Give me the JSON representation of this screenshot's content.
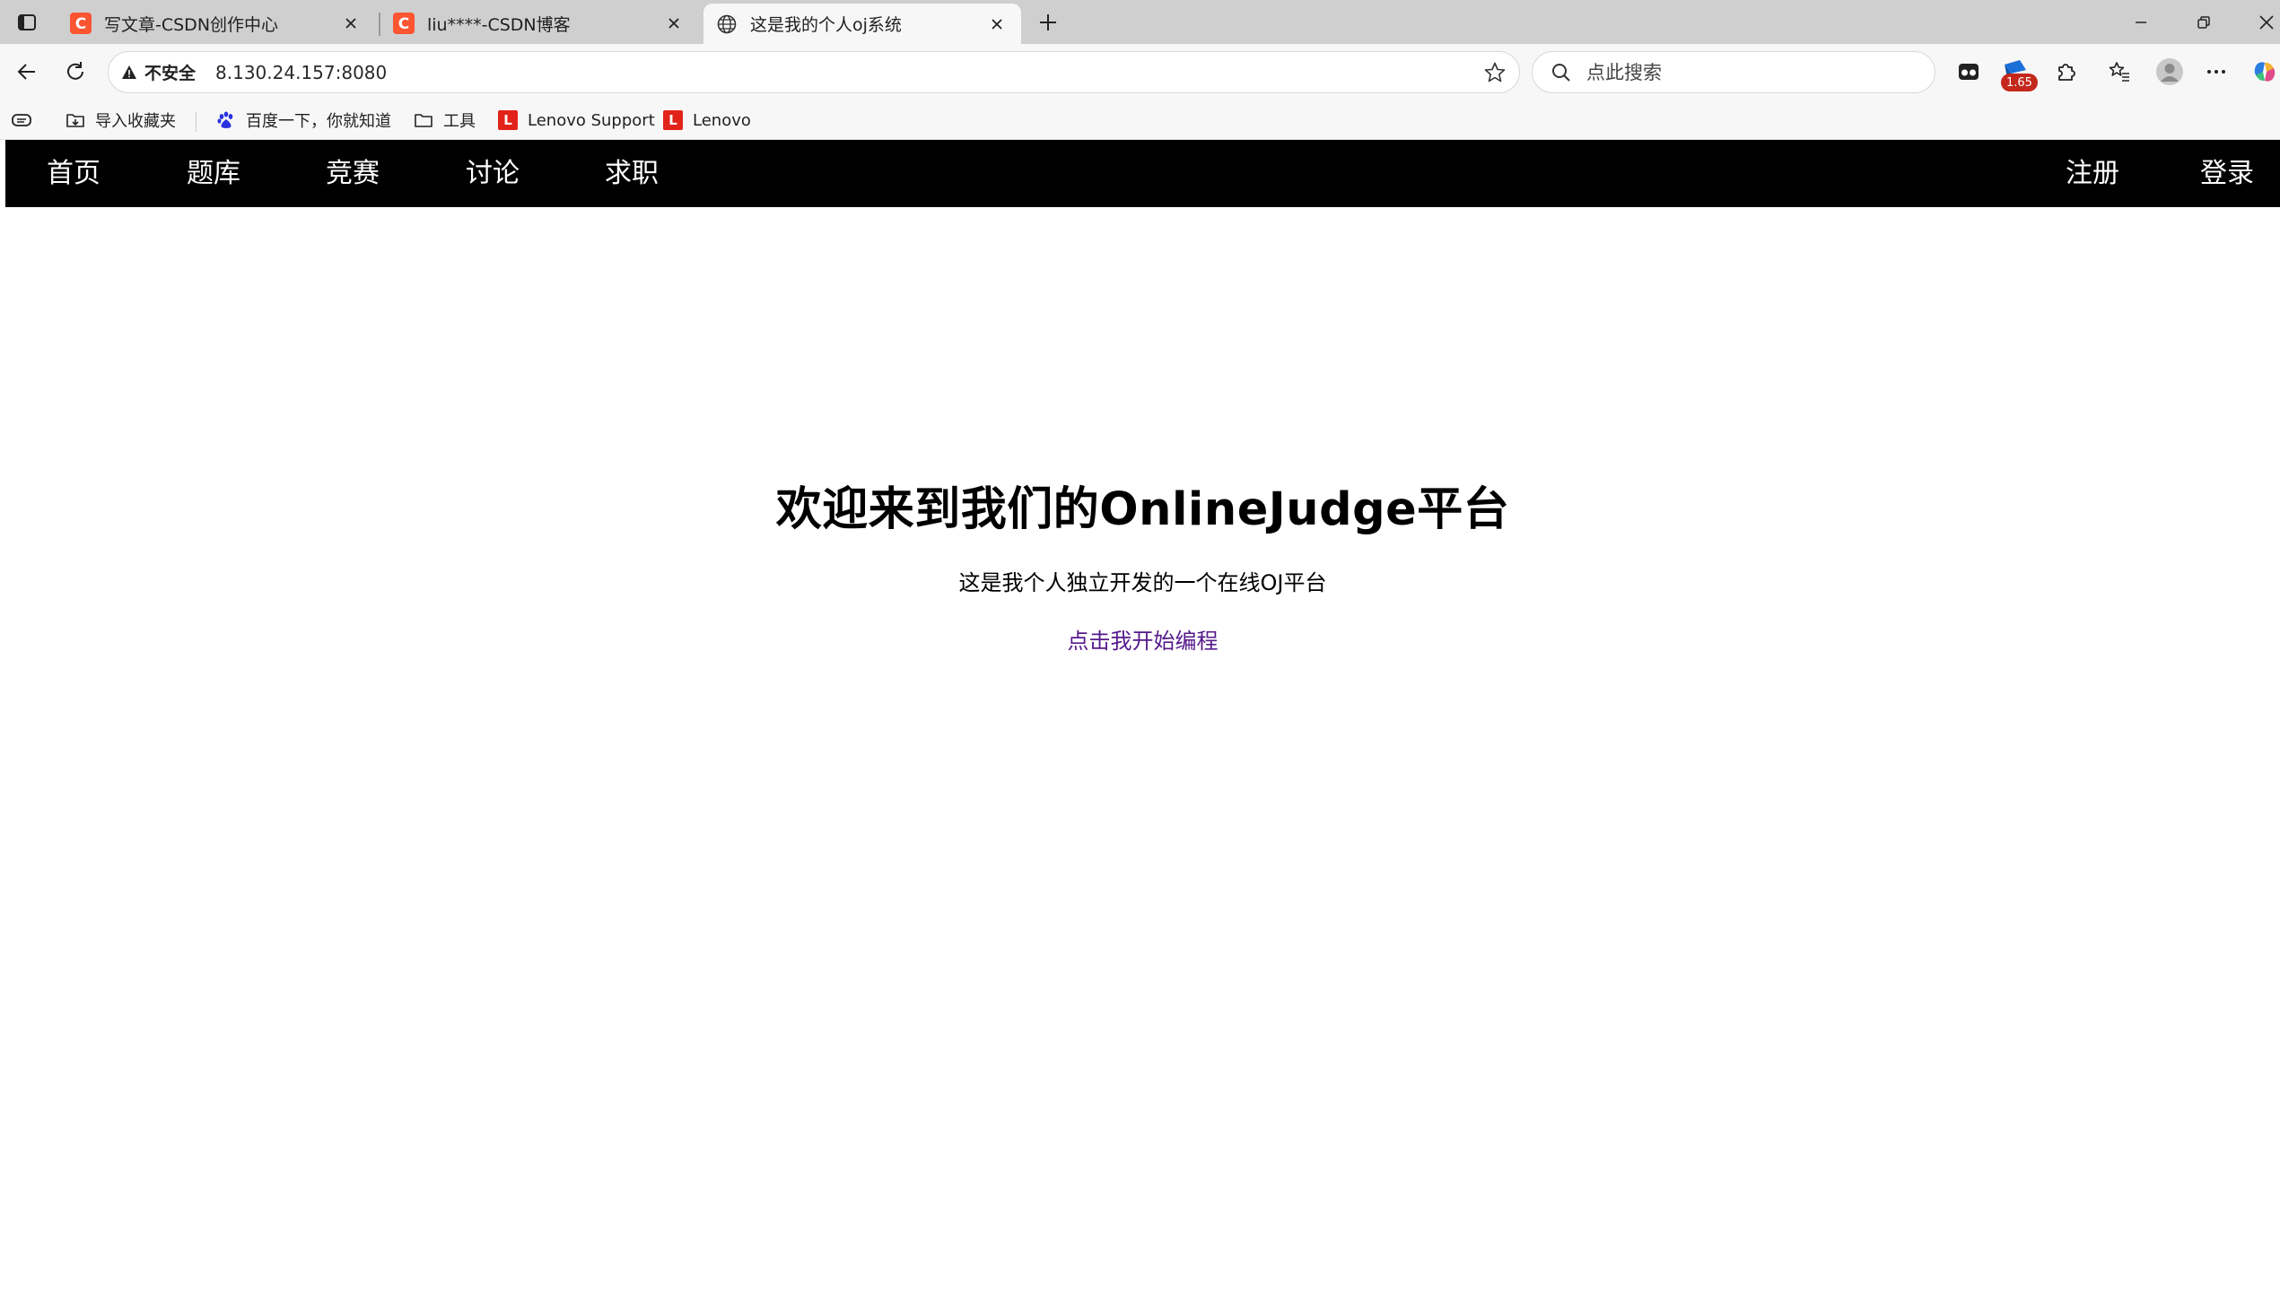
{
  "browser": {
    "tabs": [
      {
        "title": "写文章-CSDN创作中心",
        "icon": "csdn-logo-icon",
        "active": false
      },
      {
        "title": "liu****-CSDN博客",
        "icon": "csdn-logo-icon",
        "active": false
      },
      {
        "title": "这是我的个人oj系统",
        "icon": "globe-icon",
        "active": true
      }
    ],
    "address": {
      "security_label": "不安全",
      "url": "8.130.24.157:8080"
    },
    "search": {
      "placeholder": "点此搜索"
    },
    "extension_badge": "1.65",
    "bookmarks": [
      {
        "label": "导入收藏夹",
        "icon": "import-favorites-icon"
      },
      {
        "label": "百度一下，你就知道",
        "icon": "baidu-paw-icon"
      },
      {
        "label": "工具",
        "icon": "folder-icon"
      },
      {
        "label": "Lenovo Support",
        "icon": "lenovo-logo-icon"
      },
      {
        "label": "Lenovo",
        "icon": "lenovo-logo-icon"
      }
    ],
    "colors": {
      "tabstrip_bg": "#cfcfcf",
      "toolbar_bg": "#f7f7f7",
      "csdn_red": "#fc5531",
      "lenovo_red": "#e2231a",
      "badge_red": "#c4281c"
    }
  },
  "page": {
    "nav": {
      "left": [
        "首页",
        "题库",
        "竞赛",
        "讨论",
        "求职"
      ],
      "right": [
        "注册",
        "登录"
      ],
      "bg_color": "#000000"
    },
    "hero": {
      "title": "欢迎来到我们的OnlineJudge平台",
      "subtitle": "这是我个人独立开发的一个在线OJ平台",
      "cta_link": "点击我开始编程",
      "link_color": "#551a8b"
    }
  }
}
